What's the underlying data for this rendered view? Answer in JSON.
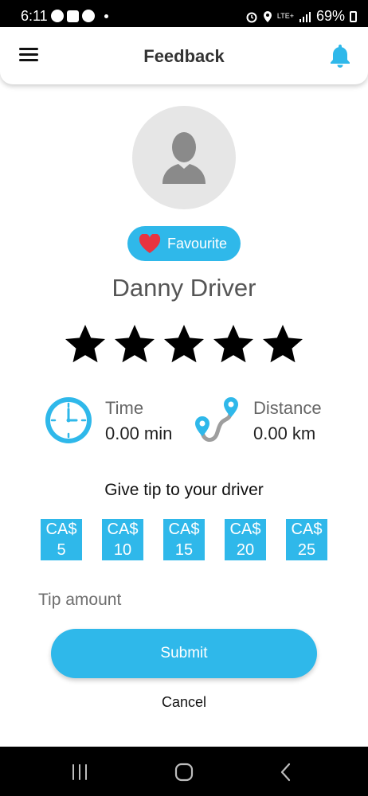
{
  "status_bar": {
    "time": "6:11",
    "network": "LTE+",
    "battery": "69%"
  },
  "appbar": {
    "title": "Feedback",
    "menu_icon": "hamburger-menu-icon",
    "notification_icon": "bell-icon"
  },
  "driver": {
    "favourite_label": "Favourite",
    "name": "Danny Driver",
    "rating_stars": 5
  },
  "stats": {
    "time_label": "Time",
    "time_value": "0.00 min",
    "distance_label": "Distance",
    "distance_value": "0.00 km"
  },
  "tip": {
    "title": "Give tip to your driver",
    "options": [
      {
        "currency": "CA$",
        "amount": "5"
      },
      {
        "currency": "CA$",
        "amount": "10"
      },
      {
        "currency": "CA$",
        "amount": "15"
      },
      {
        "currency": "CA$",
        "amount": "20"
      },
      {
        "currency": "CA$",
        "amount": "25"
      }
    ],
    "input_placeholder": "Tip amount"
  },
  "actions": {
    "submit_label": "Submit",
    "cancel_label": "Cancel"
  },
  "colors": {
    "accent": "#2fb8ea",
    "heart": "#e8333f"
  }
}
